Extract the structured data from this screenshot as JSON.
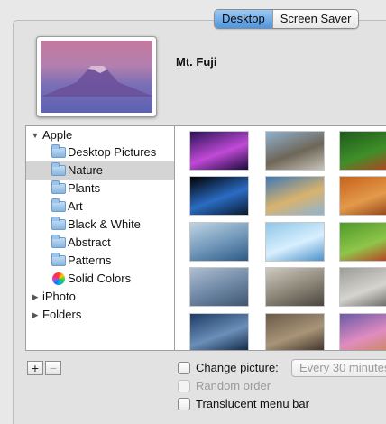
{
  "tabs": [
    {
      "label": "Desktop",
      "active": true
    },
    {
      "label": "Screen Saver",
      "active": false
    }
  ],
  "current_picture": {
    "name": "Mt. Fuji"
  },
  "source_list": [
    {
      "label": "Apple",
      "type": "group",
      "disclosure": "expanded"
    },
    {
      "label": "Desktop Pictures",
      "type": "folder"
    },
    {
      "label": "Nature",
      "type": "folder",
      "selected": true
    },
    {
      "label": "Plants",
      "type": "folder"
    },
    {
      "label": "Art",
      "type": "folder"
    },
    {
      "label": "Black & White",
      "type": "folder"
    },
    {
      "label": "Abstract",
      "type": "folder"
    },
    {
      "label": "Patterns",
      "type": "folder"
    },
    {
      "label": "Solid Colors",
      "type": "color-wheel"
    },
    {
      "label": "iPhoto",
      "type": "group",
      "disclosure": "collapsed"
    },
    {
      "label": "Folders",
      "type": "group",
      "disclosure": "collapsed"
    }
  ],
  "thumbnails": [
    {
      "name": "aurora",
      "colors": [
        "#2a1357",
        "#c04ad6",
        "#1b0b3a"
      ]
    },
    {
      "name": "mountain-cliffs",
      "colors": [
        "#8fb1cf",
        "#6e6658",
        "#c8c3b8"
      ]
    },
    {
      "name": "green-leaves-ladybug",
      "colors": [
        "#1e5a1a",
        "#3f8f2a",
        "#c23a20"
      ]
    },
    {
      "name": "earth",
      "colors": [
        "#000000",
        "#2b6cc4",
        "#0a1a2e"
      ]
    },
    {
      "name": "sunset-water",
      "colors": [
        "#3e78b5",
        "#d9b36d",
        "#8fb3d4"
      ]
    },
    {
      "name": "orange-sandstone",
      "colors": [
        "#c7621c",
        "#e39a4a",
        "#8a3a12"
      ]
    },
    {
      "name": "sea-horizon",
      "colors": [
        "#bfd3e2",
        "#6e95b8",
        "#2c5a85"
      ]
    },
    {
      "name": "ice-blue",
      "colors": [
        "#8ec6e8",
        "#d8efff",
        "#4c93c8"
      ]
    },
    {
      "name": "green-ladybug",
      "colors": [
        "#4d9a2a",
        "#8fc54a",
        "#c12e1c"
      ]
    },
    {
      "name": "reeds-blue",
      "colors": [
        "#aebfd2",
        "#6c85a3",
        "#3f5670"
      ]
    },
    {
      "name": "zen-garden",
      "colors": [
        "#cfcac0",
        "#8a8476",
        "#4a463e"
      ]
    },
    {
      "name": "grey-pebbles",
      "colors": [
        "#9c9c98",
        "#d5d4cf",
        "#5d5d59"
      ]
    },
    {
      "name": "sand-dunes-blue",
      "colors": [
        "#1d3c66",
        "#6a8fb8",
        "#0f2340"
      ]
    },
    {
      "name": "pebbles-brown",
      "colors": [
        "#6b5a48",
        "#a89478",
        "#3b3027"
      ]
    },
    {
      "name": "purple-sky",
      "colors": [
        "#6a5aa8",
        "#e08cc0",
        "#c88a50"
      ]
    }
  ],
  "bottom": {
    "add_label": "+",
    "remove_label": "−",
    "change_picture_label": "Change picture:",
    "interval_value": "Every 30 minutes",
    "random_order_label": "Random order",
    "translucent_label": "Translucent menu bar"
  },
  "colors": {
    "accent": "#4f95e0",
    "selection": "#d4d4d4"
  }
}
